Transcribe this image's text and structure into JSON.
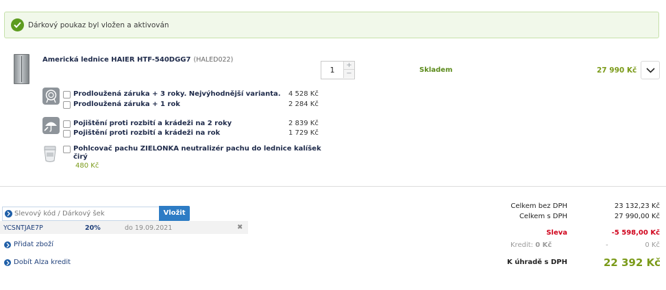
{
  "banner": {
    "message": "Dárkový poukaz byl vložen a aktivován",
    "icon": "check-icon"
  },
  "product": {
    "name": "Americká lednice HAIER HTF-540DGG7",
    "code": "(HALED022)",
    "quantity": "1",
    "stock": "Skladem",
    "price": "27 990 Kč",
    "services": [
      {
        "icon": "warranty-icon",
        "options": [
          {
            "label": "Prodloužená záruka + 3 roky. Nejvýhodnější varianta.",
            "price": "4 528 Kč"
          },
          {
            "label": "Prodloužená záruka + 1 rok",
            "price": "2 284 Kč"
          }
        ]
      },
      {
        "icon": "insurance-umbrella-icon",
        "options": [
          {
            "label": "Pojištění proti rozbití a krádeži na 2 roky",
            "price": "2 839 Kč"
          },
          {
            "label": "Pojištění proti rozbití a krádeži na rok",
            "price": "1 729 Kč"
          }
        ]
      }
    ],
    "accessory": {
      "label": "Pohlcovač pachu ZIELONKA neutralizér pachu do lednice kalíšek čirý",
      "price": "480 Kč"
    }
  },
  "voucher": {
    "placeholder": "Slevový kód / Dárkový šek",
    "button": "Vložit",
    "applied": {
      "code": "YCSNTJAE7P",
      "percent": "20%",
      "valid": "do 19.09.2021"
    }
  },
  "links": {
    "add_goods": "Přidat zboží",
    "topup_credit": "Dobít Alza kredit"
  },
  "totals": {
    "without_vat_label": "Celkem bez DPH",
    "without_vat": "23 132,23 Kč",
    "with_vat_label": "Celkem s DPH",
    "with_vat": "27 990,00 Kč",
    "discount_label": "Sleva",
    "discount": "-5 598,00 Kč",
    "credit_label": "Kredit:",
    "credit_amount": "0 Kč",
    "credit_sep": "-",
    "credit_value": "0 Kč",
    "pay_label": "K úhradě s DPH",
    "pay": "22 392 Kč"
  },
  "colors": {
    "accent_green": "#7a9a18",
    "discount_red": "#d0021b",
    "link_blue": "#1e3f7a",
    "button_blue": "#2d7cc5"
  }
}
